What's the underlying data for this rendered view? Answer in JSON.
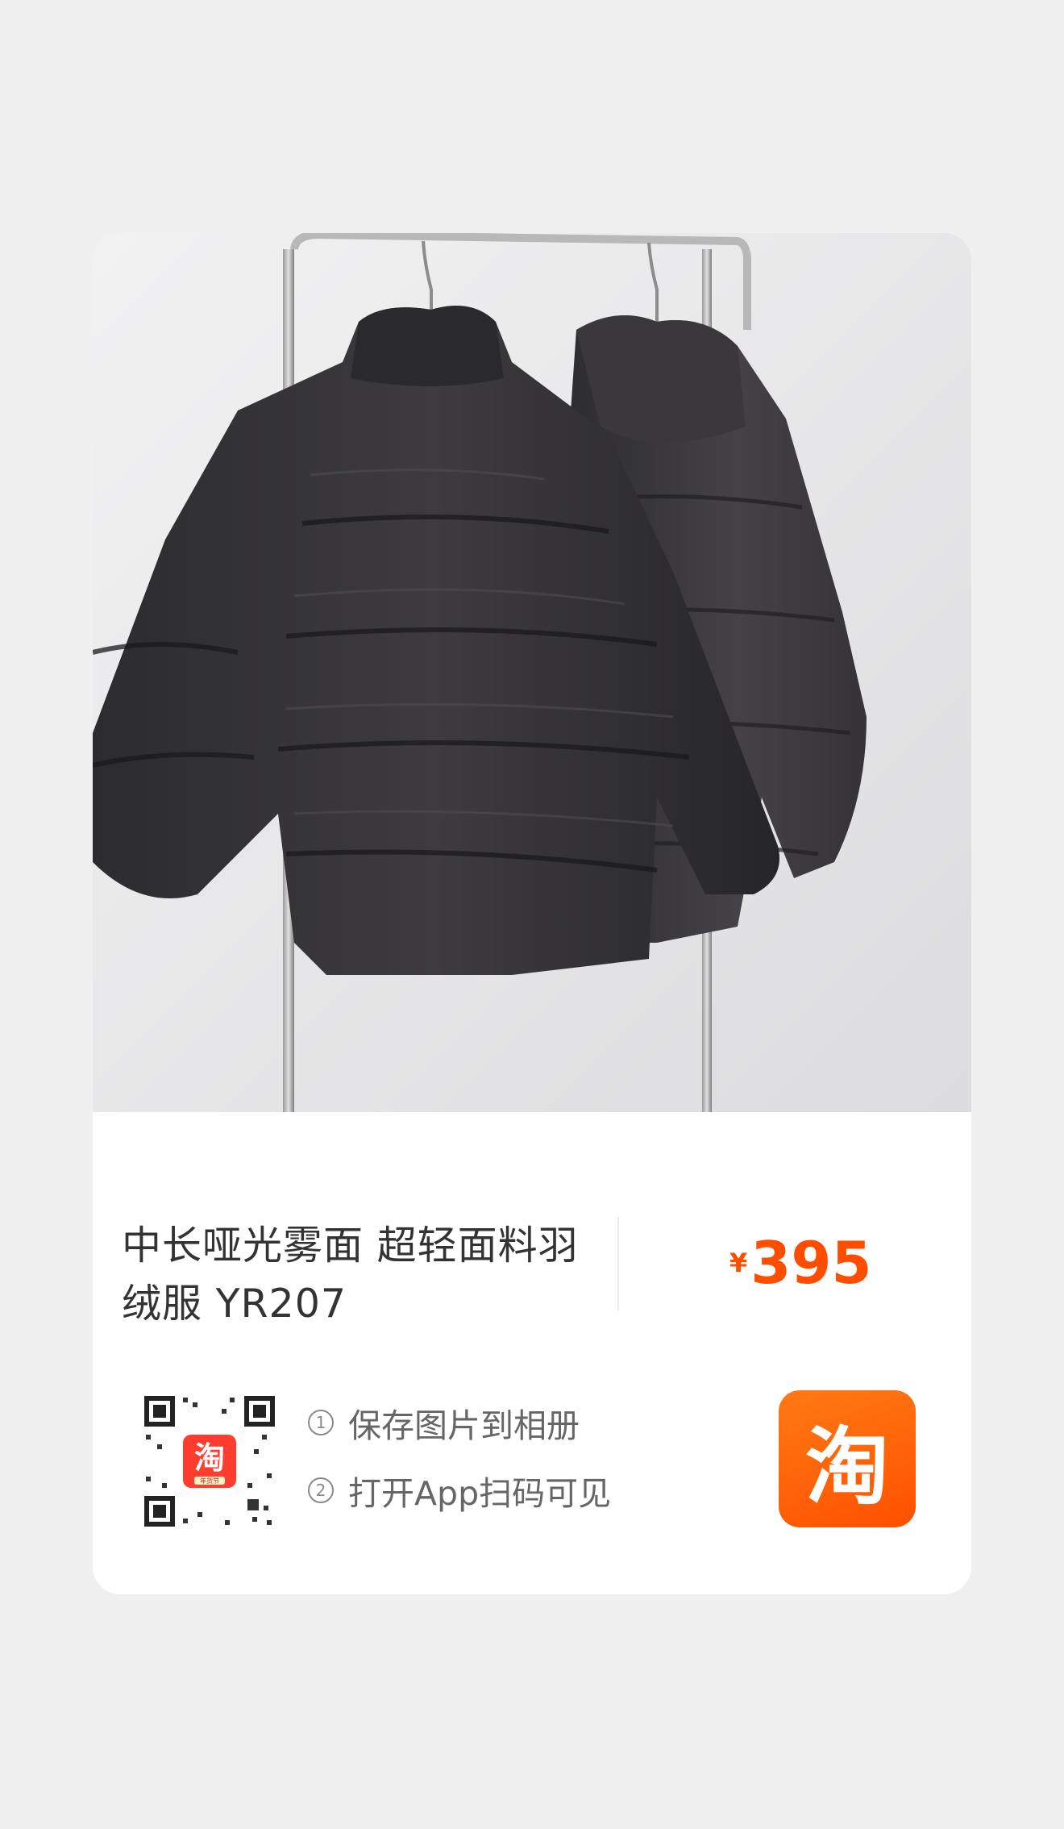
{
  "product": {
    "title": "中长哑光雾面 超轻面料羽绒服 YR207",
    "image_alt": "black puffer down jackets on clothing rack"
  },
  "price": {
    "currency": "¥",
    "amount": "395"
  },
  "share": {
    "step1_num": "1",
    "step1": "保存图片到相册",
    "step2_num": "2",
    "step2": "打开App扫码可见"
  },
  "brand": {
    "logo_char": "淘",
    "mini_logo_char": "淘",
    "mini_logo_sub": "年货节",
    "color": "#ff5000"
  }
}
